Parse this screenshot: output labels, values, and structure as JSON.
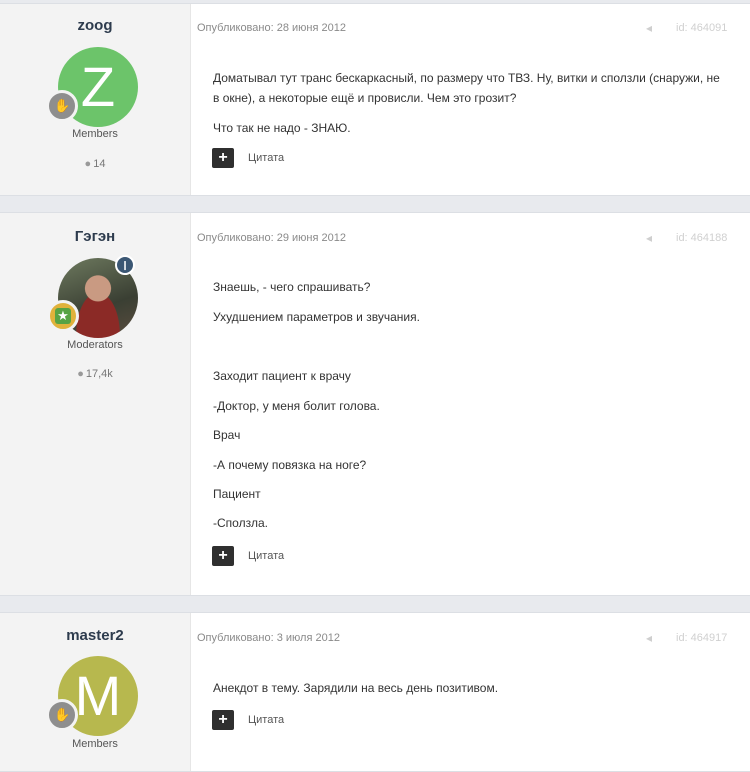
{
  "posts": [
    {
      "author": "zoog",
      "avatar_letter": "Z",
      "avatar_color": "#6cc46a",
      "group": "Members",
      "count": "14",
      "date": "Опубликовано: 28 июня 2012",
      "id": "id: 464091",
      "lines": [
        "Доматывал тут транс бескаркасный, по размеру что ТВЗ. Ну, витки и сползли (снаружи, не",
        "в окне), а некоторые ещё и провисли. Чем это грозит?",
        "Что так не надо - ЗНАЮ."
      ],
      "quote_label": "Цитата"
    },
    {
      "author": "Гэгэн",
      "group": "Moderators",
      "count": "17,4k",
      "date": "Опубликовано: 29 июня 2012",
      "id": "id: 464188",
      "lines": [
        "Знаешь, - чего спрашивать?",
        "Ухудшением параметров и звучания.",
        "Заходит пациент к врачу",
        "-Доктор, у меня болит голова.",
        "Врач",
        "-А почему повязка на ноге?",
        "Пациент",
        "-Сползла."
      ],
      "quote_label": "Цитата"
    },
    {
      "author": "master2",
      "avatar_letter": "M",
      "avatar_color": "#b7b84e",
      "group": "Members",
      "date": "Опубликовано: 3 июля 2012",
      "id": "id: 464917",
      "lines": [
        "Анекдот в тему. Зарядили на весь день позитивом."
      ],
      "quote_label": "Цитата"
    }
  ],
  "icons": {
    "plus": "+",
    "comment": "💬",
    "share": "⋖"
  }
}
